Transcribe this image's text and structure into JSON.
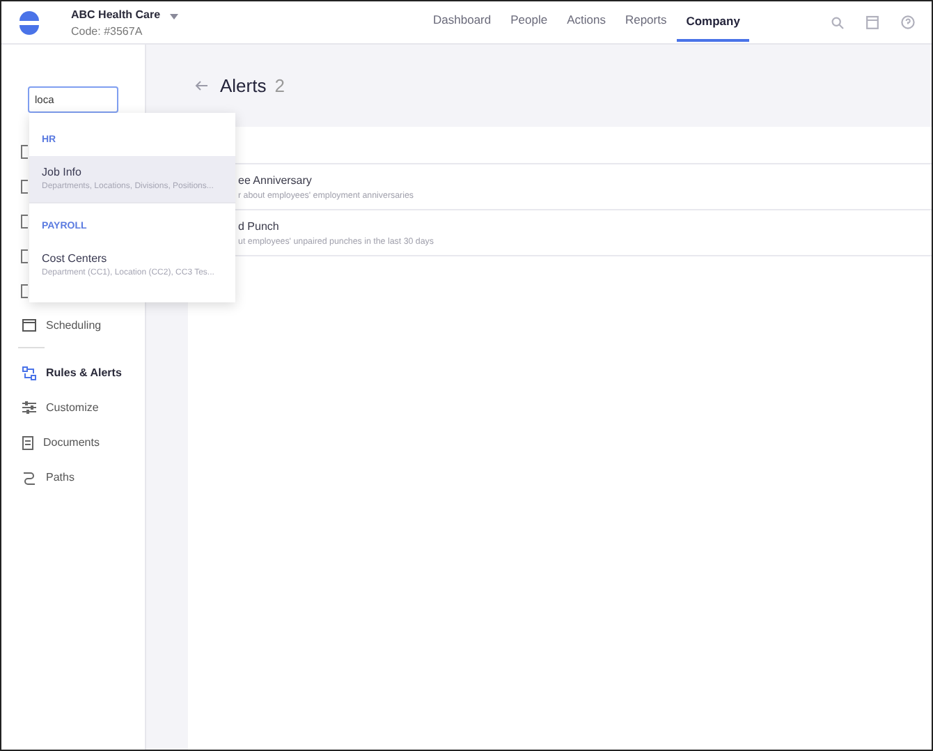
{
  "company": {
    "name": "ABC Health Care",
    "code": "Code: #3567A"
  },
  "nav": [
    {
      "label": "Dashboard",
      "selected": false
    },
    {
      "label": "People",
      "selected": false
    },
    {
      "label": "Actions",
      "selected": false
    },
    {
      "label": "Reports",
      "selected": false
    },
    {
      "label": "Company",
      "selected": true
    }
  ],
  "search": {
    "value": "loca"
  },
  "dropdown": [
    {
      "heading": "HR",
      "items": [
        {
          "title": "Job Info",
          "detail": "Departments, Locations, Divisions, Positions...",
          "selected": true
        }
      ]
    },
    {
      "heading": "PAYROLL",
      "items": [
        {
          "title": "Cost Centers",
          "detail": "Department (CC1), Location (CC2), CC3 Tes...",
          "selected": false
        }
      ]
    }
  ],
  "sidebar": {
    "items": [
      {
        "label": "Scheduling",
        "kind": "calendar",
        "selected": false
      }
    ],
    "items_after_divider": [
      {
        "label": "Rules & Alerts",
        "kind": "rules",
        "selected": true
      },
      {
        "label": "Customize",
        "kind": "sliders",
        "selected": false
      },
      {
        "label": "Documents",
        "kind": "document",
        "selected": false
      },
      {
        "label": "Paths",
        "kind": "path",
        "selected": false
      }
    ]
  },
  "page": {
    "title": "Alerts",
    "count": "2"
  },
  "alerts": [
    {
      "title": "ee Anniversary",
      "description": "r about employees' employment anniversaries"
    },
    {
      "title": "d Punch",
      "description": "ut employees' unpaired punches in the last 30 days"
    }
  ]
}
